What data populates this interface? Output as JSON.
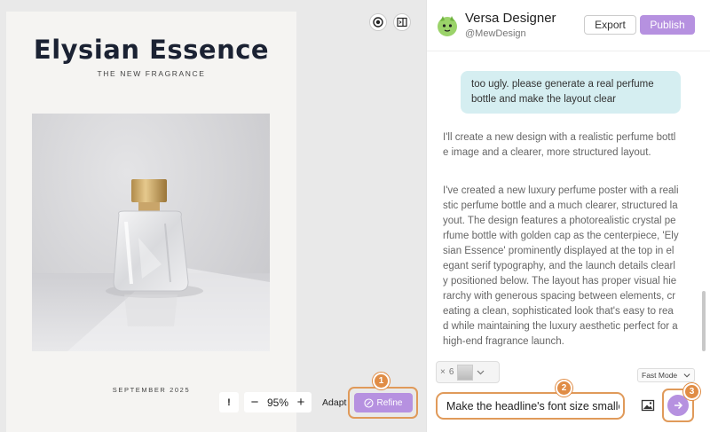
{
  "poster": {
    "title": "Elysian Essence",
    "subtitle": "THE NEW FRAGRANCE",
    "date": "SEPTEMBER 2025"
  },
  "toolbar": {
    "warning_label": "!",
    "zoom_minus": "−",
    "zoom_value": "95%",
    "zoom_plus": "+",
    "adapt_label": "Adapt",
    "refine_label": "Refine"
  },
  "markers": [
    "1",
    "2",
    "3"
  ],
  "header": {
    "app_name": "Versa Designer",
    "handle": "@MewDesign",
    "export_label": "Export",
    "publish_label": "Publish"
  },
  "chat": {
    "user_message": "too ugly. please generate a real perfume bottle and make the layout clear",
    "bot_message_1": "I'll create a new design with a realistic perfume bottle image and a clearer, more structured layout.",
    "bot_message_2": "I've created a new luxury perfume poster with a realistic perfume bottle and a much clearer, structured layout. The design features a photorealistic crystal perfume bottle with golden cap as the centerpiece, 'Elysian Essence' prominently displayed at the top in elegant serif typography, and the launch details clearly positioned below. The layout has proper visual hierarchy with generous spacing between elements, creating a clean, sophisticated look that's easy to read while maintaining the luxury aesthetic perfect for a high-end fragrance launch."
  },
  "composer": {
    "attachment_close": "×",
    "attachment_count": "6",
    "mode": "Fast Mode",
    "input_value": "Make the headline's font size smaller"
  },
  "colors": {
    "accent": "#b691e0",
    "highlight": "#e09a5a",
    "user_bubble": "#d5eef1",
    "title": "#1b2233"
  }
}
